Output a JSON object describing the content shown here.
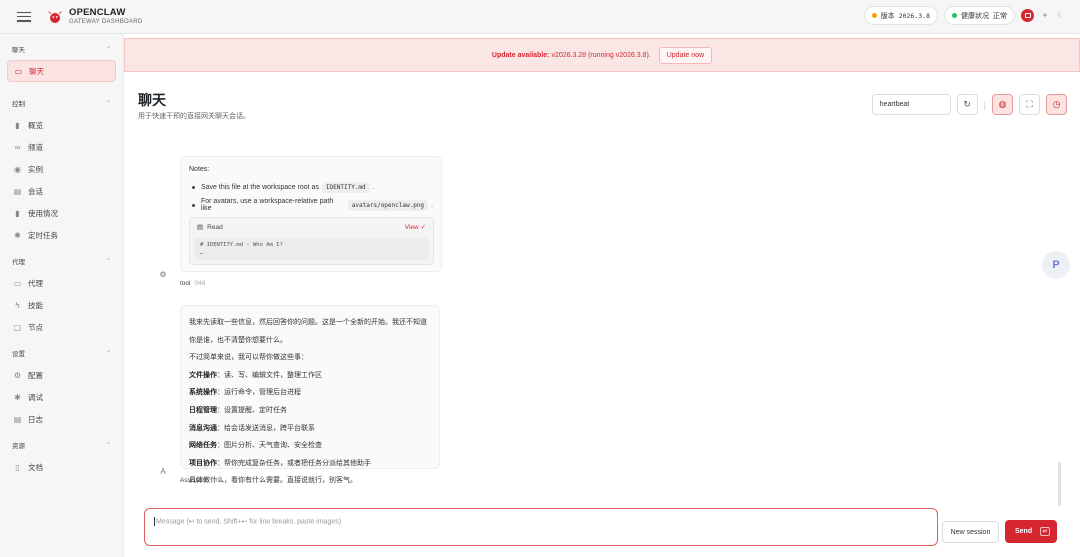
{
  "app": {
    "brand_title": "OPENCLAW",
    "brand_subtitle": "GATEWAY DASHBOARD",
    "accent": "#d6262f"
  },
  "status": {
    "version_label": "版本",
    "version_value": "2026.3.8",
    "health_label": "健康状况",
    "health_value": "正常",
    "version_dot": "#f59e0b",
    "health_dot": "#22c55e"
  },
  "sidebar": {
    "groups": [
      {
        "label": "聊天",
        "items": [
          {
            "label": "聊天",
            "icon": "chat-icon",
            "active": true
          }
        ]
      },
      {
        "label": "控制",
        "items": [
          {
            "label": "概览",
            "icon": "bar-chart-icon"
          },
          {
            "label": "频道",
            "icon": "link-icon"
          },
          {
            "label": "实例",
            "icon": "radio-icon"
          },
          {
            "label": "会话",
            "icon": "document-icon"
          },
          {
            "label": "使用情况",
            "icon": "bar-chart-icon"
          },
          {
            "label": "定时任务",
            "icon": "loader-icon"
          }
        ]
      },
      {
        "label": "代理",
        "items": [
          {
            "label": "代理",
            "icon": "folder-icon"
          },
          {
            "label": "技能",
            "icon": "zap-icon"
          },
          {
            "label": "节点",
            "icon": "monitor-icon"
          }
        ]
      },
      {
        "label": "设置",
        "items": [
          {
            "label": "配置",
            "icon": "gear-icon"
          },
          {
            "label": "调试",
            "icon": "bug-icon"
          },
          {
            "label": "日志",
            "icon": "file-text-icon"
          }
        ]
      },
      {
        "label": "资源",
        "items": [
          {
            "label": "文档",
            "icon": "book-icon"
          }
        ]
      }
    ]
  },
  "banner": {
    "title": "Update available:",
    "detail": "v2026.3.28 (running v2026.3.8).",
    "button": "Update now"
  },
  "page": {
    "title": "聊天",
    "subtitle": "用于快速干预的直接网关聊天会话。",
    "session_value": "heartbeat"
  },
  "messages": {
    "tool": {
      "notes_label": "Notes:",
      "bullet1_pre": "Save this file at the workspace root as",
      "bullet1_code": "IDENTITY.md",
      "bullet1_post": ".",
      "bullet2_pre": "For avatars, use a workspace-relative path like",
      "bullet2_code": "avatars/openclaw.png",
      "bullet2_post": ".",
      "read_label": "Read",
      "view_label": "View ✓",
      "code_line1": "# IDENTITY.md - Who Am I?",
      "code_line2": "…",
      "author": "tool",
      "time": "048"
    },
    "assistant": {
      "line1": "我来先读取一些信息，然后回答你的问题。这是一个全新的开始。我还不知道你是谁，也不清楚你想要什么。",
      "line2": "不过简单来说，我可以帮你做这些事：",
      "items": [
        {
          "k": "文件操作",
          "v": "：读、写、编辑文件，整理工作区"
        },
        {
          "k": "系统操作",
          "v": "：运行命令，管理后台进程"
        },
        {
          "k": "日程管理",
          "v": "：设置提醒、定时任务"
        },
        {
          "k": "消息沟通",
          "v": "：给会话发送消息，跨平台联系"
        },
        {
          "k": "网络任务",
          "v": "：图片分析、天气查询、安全检查"
        },
        {
          "k": "项目协作",
          "v": "：帮你完成复杂任务，或者把任务分派给其他助手"
        }
      ],
      "closing": "具体做什么，看你有什么需要。直接说就行，别客气。",
      "avatar": "A",
      "author": "Assistant",
      "time": "049"
    }
  },
  "composer": {
    "placeholder": "Message (↩ to send, Shift+↩ for line breaks, paste images)",
    "new_session": "New session",
    "send": "Send",
    "send_kbd": "↵"
  },
  "floating_badge": "P"
}
